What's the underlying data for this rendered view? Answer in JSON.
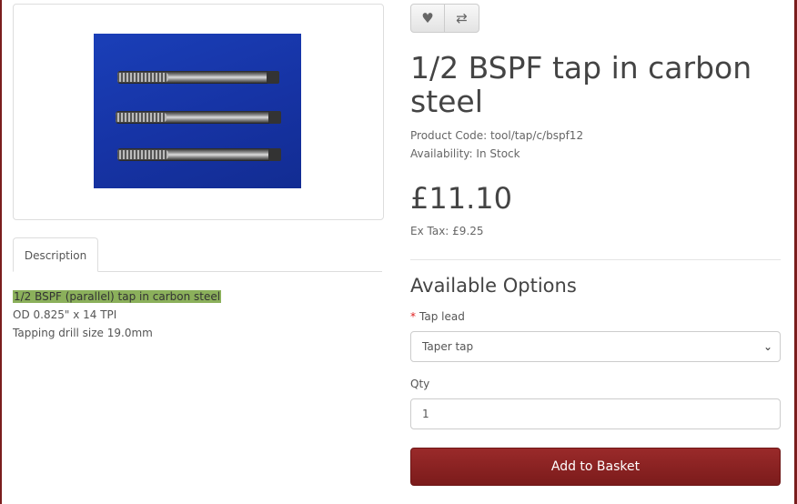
{
  "gallery": {
    "image_alt": "three taps on blue background"
  },
  "tabs": {
    "description_label": "Description"
  },
  "description": {
    "lines": [
      "1/2 BSPF (parallel) tap in carbon steel",
      "OD 0.825\" x 14 TPI",
      "Tapping drill size 19.0mm"
    ]
  },
  "actions": {
    "wishlist_icon": "heart-icon",
    "compare_icon": "compare-icon"
  },
  "product": {
    "title": "1/2 BSPF tap in carbon steel",
    "code_label": "Product Code:",
    "code": "tool/tap/c/bspf12",
    "availability_label": "Availability:",
    "availability": "In Stock",
    "price": "£11.10",
    "ex_tax_label": "Ex Tax:",
    "ex_tax": "£9.25"
  },
  "options": {
    "title": "Available Options",
    "tap_lead_label": "Tap lead",
    "tap_lead_selected": "Taper tap",
    "qty_label": "Qty",
    "qty_value": "1"
  },
  "cart": {
    "button_label": "Add to Basket"
  },
  "colors": {
    "accent": "#7b1b1b",
    "photo_bg": "#1633a4",
    "highlight": "#8bb05b"
  }
}
